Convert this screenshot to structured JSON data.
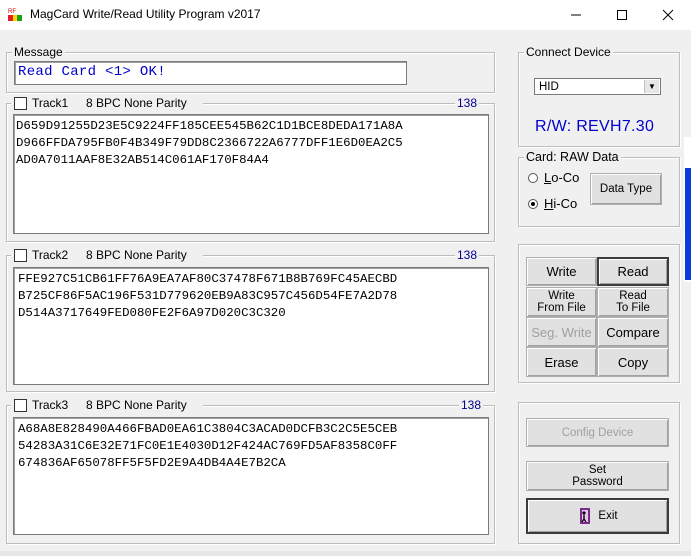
{
  "window": {
    "title": "MagCard Write/Read Utility Program  v2017"
  },
  "message": {
    "legend": "Message",
    "text": "Read Card <1> OK!"
  },
  "tracks": [
    {
      "label": "Track1",
      "format": "8 BPC  None Parity",
      "count": "138",
      "data": "D659D91255D23E5C9224FF185CEE545B62C1D1BCE8DEDA171A8A\nD966FFDA795FB0F4B349F79DD8C2366722A6777DFF1E6D0EA2C5\nAD0A7011AAF8E32AB514C061AF170F84A4"
    },
    {
      "label": "Track2",
      "format": "8 BPC  None Parity",
      "count": "138",
      "data": "FFE927C51CB61FF76A9EA7AF80C37478F671B8B769FC45AECBD\nB725CF86F5AC196F531D779620EB9A83C957C456D54FE7A2D78\nD514A3717649FED080FE2F6A97D020C3C320"
    },
    {
      "label": "Track3",
      "format": "8 BPC  None Parity",
      "count": "138",
      "data": "A68A8E828490A466FBAD0EA61C3804C3ACAD0DCFB3C2C5E5CEB\n54283A31C6E32E71FC0E1E4030D12F424AC769FD5AF8358C0FF\n674836AF65078FF5F5FD2E9A4DB4A4E7B2CA"
    }
  ],
  "connect_device": {
    "legend": "Connect Device",
    "selected": "HID",
    "rw_version": "R/W: REVH7.30"
  },
  "card": {
    "legend": "Card: RAW Data",
    "loco": "Lo-Co",
    "hico": "Hi-Co",
    "selected": "Hi-Co",
    "data_type_button": "Data Type"
  },
  "actions": {
    "write": "Write",
    "read": "Read",
    "write_from_file_1": "Write",
    "write_from_file_2": "From File",
    "read_to_file_1": "Read",
    "read_to_file_2": "To File",
    "seg_write": "Seg. Write",
    "compare": "Compare",
    "erase": "Erase",
    "copy": "Copy"
  },
  "system": {
    "config_device": "Config Device",
    "set_password_1": "Set",
    "set_password_2": "Password",
    "exit": "Exit"
  },
  "colors": {
    "accent_blue": "#0000cc",
    "count_blue": "#00008b",
    "side_bar_blue": "#0a3cdc"
  }
}
